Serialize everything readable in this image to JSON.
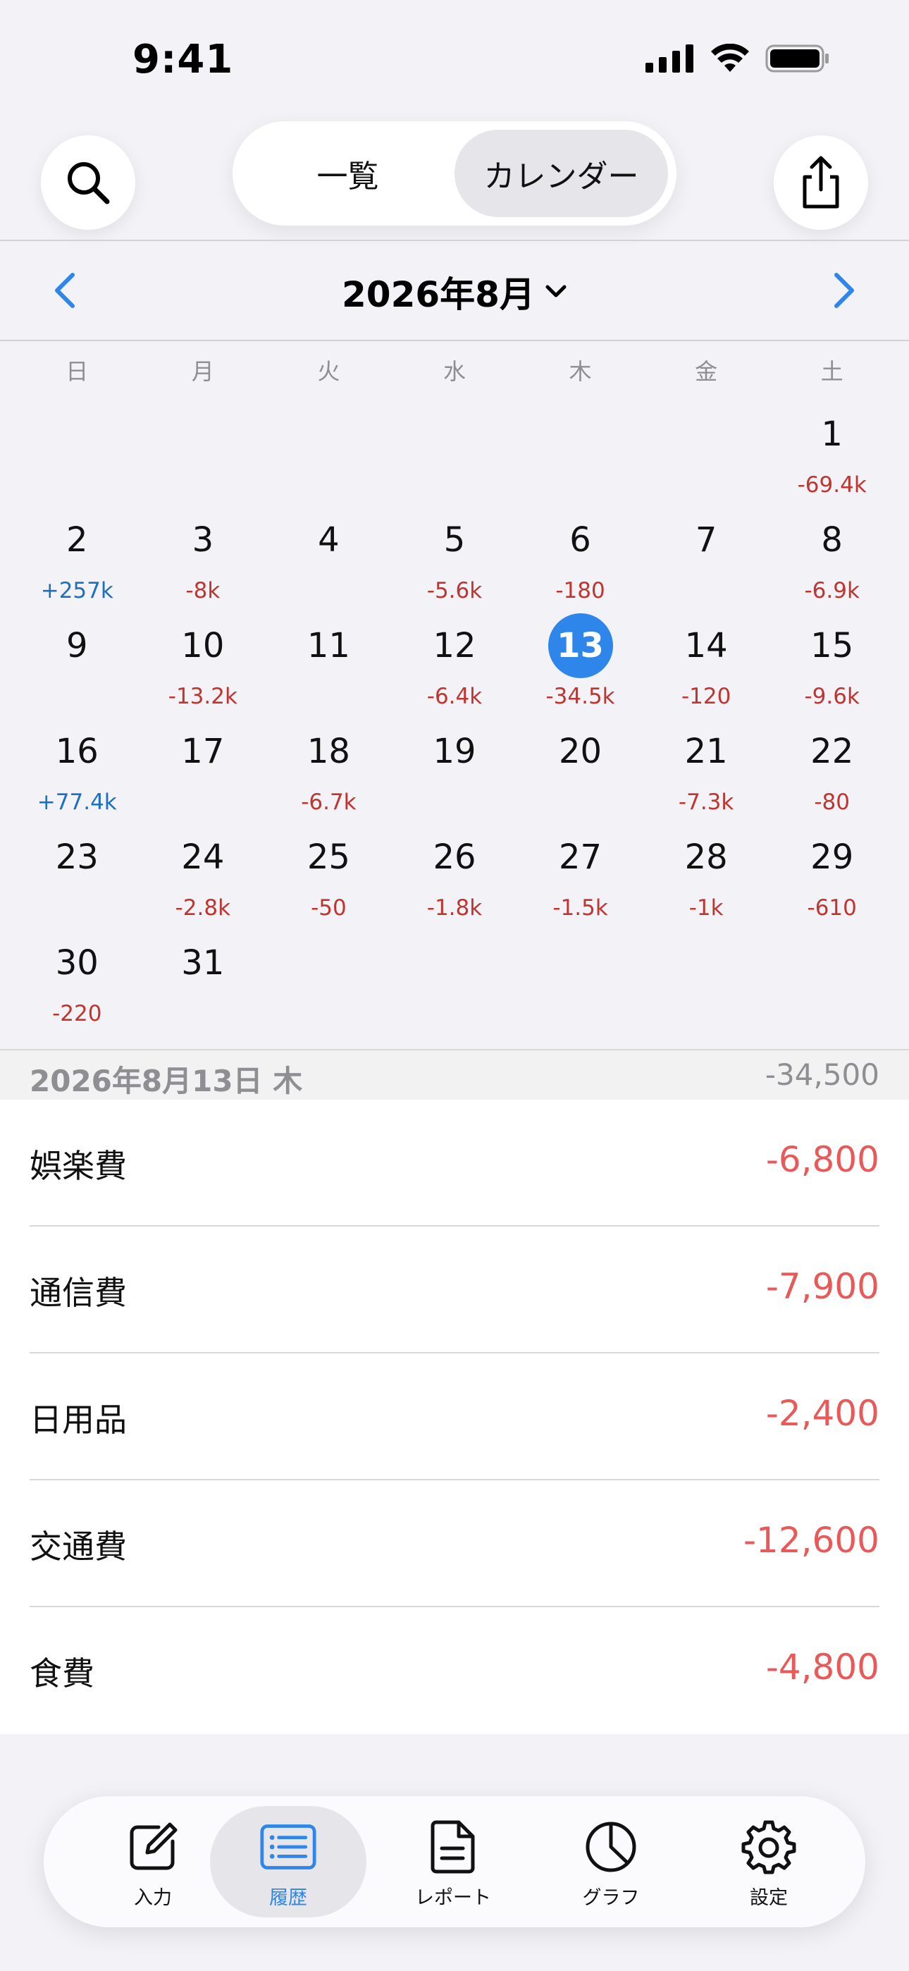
{
  "status_bar": {
    "time": "9:41"
  },
  "header": {
    "search_icon": "search-icon",
    "share_icon": "share-icon",
    "segments": [
      {
        "label": "一覧",
        "active": false
      },
      {
        "label": "カレンダー",
        "active": true
      }
    ]
  },
  "month_nav": {
    "title": "2026年8月"
  },
  "weekdays": [
    "日",
    "月",
    "火",
    "水",
    "木",
    "金",
    "土"
  ],
  "calendar": [
    {
      "day": "",
      "amount": ""
    },
    {
      "day": "",
      "amount": ""
    },
    {
      "day": "",
      "amount": ""
    },
    {
      "day": "",
      "amount": ""
    },
    {
      "day": "",
      "amount": ""
    },
    {
      "day": "",
      "amount": ""
    },
    {
      "day": "1",
      "amount": "-69.4k",
      "sign": "neg"
    },
    {
      "day": "2",
      "amount": "+257k",
      "sign": "pos"
    },
    {
      "day": "3",
      "amount": "-8k",
      "sign": "neg"
    },
    {
      "day": "4",
      "amount": ""
    },
    {
      "day": "5",
      "amount": "-5.6k",
      "sign": "neg"
    },
    {
      "day": "6",
      "amount": "-180",
      "sign": "neg"
    },
    {
      "day": "7",
      "amount": ""
    },
    {
      "day": "8",
      "amount": "-6.9k",
      "sign": "neg"
    },
    {
      "day": "9",
      "amount": ""
    },
    {
      "day": "10",
      "amount": "-13.2k",
      "sign": "neg"
    },
    {
      "day": "11",
      "amount": ""
    },
    {
      "day": "12",
      "amount": "-6.4k",
      "sign": "neg"
    },
    {
      "day": "13",
      "amount": "-34.5k",
      "sign": "neg",
      "selected": true
    },
    {
      "day": "14",
      "amount": "-120",
      "sign": "neg"
    },
    {
      "day": "15",
      "amount": "-9.6k",
      "sign": "neg"
    },
    {
      "day": "16",
      "amount": "+77.4k",
      "sign": "pos"
    },
    {
      "day": "17",
      "amount": ""
    },
    {
      "day": "18",
      "amount": "-6.7k",
      "sign": "neg"
    },
    {
      "day": "19",
      "amount": ""
    },
    {
      "day": "20",
      "amount": ""
    },
    {
      "day": "21",
      "amount": "-7.3k",
      "sign": "neg"
    },
    {
      "day": "22",
      "amount": "-80",
      "sign": "neg"
    },
    {
      "day": "23",
      "amount": ""
    },
    {
      "day": "24",
      "amount": "-2.8k",
      "sign": "neg"
    },
    {
      "day": "25",
      "amount": "-50",
      "sign": "neg"
    },
    {
      "day": "26",
      "amount": "-1.8k",
      "sign": "neg"
    },
    {
      "day": "27",
      "amount": "-1.5k",
      "sign": "neg"
    },
    {
      "day": "28",
      "amount": "-1k",
      "sign": "neg"
    },
    {
      "day": "29",
      "amount": "-610",
      "sign": "neg"
    },
    {
      "day": "30",
      "amount": "-220",
      "sign": "neg"
    },
    {
      "day": "31",
      "amount": ""
    }
  ],
  "selected_day": {
    "label": "2026年8月13日 木",
    "total": "-34,500"
  },
  "entries": [
    {
      "category": "娯楽費",
      "amount": "-6,800"
    },
    {
      "category": "通信費",
      "amount": "-7,900"
    },
    {
      "category": "日用品",
      "amount": "-2,400"
    },
    {
      "category": "交通費",
      "amount": "-12,600"
    },
    {
      "category": "食費",
      "amount": "-4,800"
    }
  ],
  "colors": {
    "accent": "#2f86ea",
    "negative": "#c0352f",
    "positive": "#1f6fbf",
    "entry_amount": "#e85a5a"
  },
  "tabbar": {
    "tabs": [
      {
        "label": "入力",
        "icon": "compose-icon",
        "active": false
      },
      {
        "label": "履歴",
        "icon": "list-icon",
        "active": true
      },
      {
        "label": "レポート",
        "icon": "document-icon",
        "active": false
      },
      {
        "label": "グラフ",
        "icon": "pie-chart-icon",
        "active": false
      },
      {
        "label": "設定",
        "icon": "gear-icon",
        "active": false
      }
    ]
  }
}
